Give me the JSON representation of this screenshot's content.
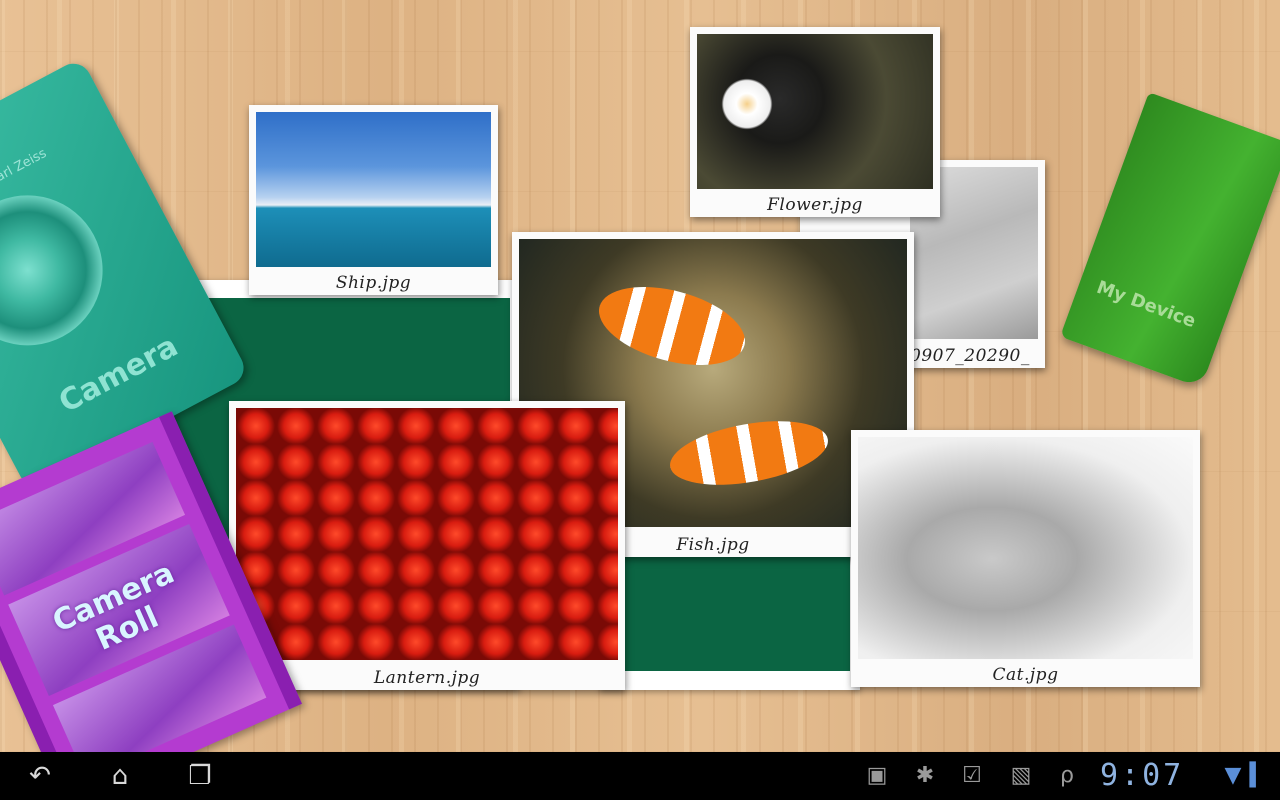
{
  "widgets": {
    "camera": {
      "label": "Camera",
      "brand": "Carl Zeiss"
    },
    "camera_roll": {
      "label_line1": "Camera",
      "label_line2": "Roll"
    },
    "my_device": {
      "label": "My Device"
    }
  },
  "photos": [
    {
      "caption": "Ship.jpg"
    },
    {
      "caption": "Flower.jpg"
    },
    {
      "caption": "0907_20290_"
    },
    {
      "caption": "Fish.jpg"
    },
    {
      "caption": "Lantern.jpg"
    },
    {
      "caption": "Cat.jpg"
    }
  ],
  "status_bar": {
    "time": "9:07",
    "icons": [
      "gallery-notification-icon",
      "usb-debugging-icon",
      "download-complete-icon",
      "market-update-icon",
      "signal-icon",
      "battery-icon"
    ]
  },
  "colors": {
    "board_green": "#0b6543",
    "camera_teal": "#2aa892",
    "roll_purple": "#b43bd0",
    "device_green": "#3aa22a",
    "clock_blue": "#8fb3e0"
  }
}
